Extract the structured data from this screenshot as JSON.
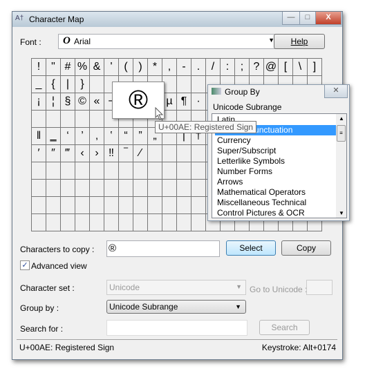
{
  "window": {
    "title": "Character Map",
    "minimize": "—",
    "maximize": "□",
    "close": "X"
  },
  "font": {
    "label": "Font :",
    "value": "Arial",
    "help": "Help"
  },
  "grid": [
    [
      "!",
      "\"",
      "#",
      "%",
      "&",
      "'",
      "(",
      ")",
      "*",
      ",",
      "-",
      ".",
      "/",
      ":",
      ";",
      "?",
      "@",
      "[",
      "\\",
      "]"
    ],
    [
      "_",
      "{",
      "|",
      "}",
      "",
      "",
      "",
      "",
      "",
      "",
      "",
      "",
      "",
      "",
      "",
      "",
      "",
      "",
      "",
      ""
    ],
    [
      "¡",
      "¦",
      "§",
      "©",
      "«",
      "¬",
      "",
      "",
      "",
      "µ",
      "¶",
      "·",
      "",
      "",
      "",
      "",
      "",
      "",
      "",
      ""
    ],
    [
      "",
      "",
      "",
      "",
      "",
      "",
      "",
      "",
      "",
      "",
      "",
      "",
      "",
      "",
      "",
      "",
      "",
      "",
      "",
      ""
    ],
    [
      "‖",
      "‗",
      "‘",
      "’",
      "‚",
      "‛",
      "“",
      "”",
      "„",
      "",
      "|",
      "†",
      "",
      "",
      "",
      "",
      "",
      "",
      "",
      ""
    ],
    [
      "′",
      "″",
      "‴",
      "‹",
      "›",
      "‼",
      "‾",
      "⁄",
      "",
      "",
      "",
      "",
      "",
      "",
      "",
      "",
      "",
      "",
      "",
      ""
    ],
    [
      "",
      "",
      "",
      "",
      "",
      "",
      "",
      "",
      "",
      "",
      "",
      "",
      "",
      "",
      "",
      "",
      "",
      "",
      "",
      ""
    ],
    [
      "",
      "",
      "",
      "",
      "",
      "",
      "",
      "",
      "",
      "",
      "",
      "",
      "",
      "",
      "",
      "",
      "",
      "",
      "",
      ""
    ],
    [
      "",
      "",
      "",
      "",
      "",
      "",
      "",
      "",
      "",
      "",
      "",
      "",
      "",
      "",
      "",
      "",
      "",
      "",
      "",
      ""
    ],
    [
      "",
      "",
      "",
      "",
      "",
      "",
      "",
      "",
      "",
      "",
      "",
      "",
      "",
      "",
      "",
      "",
      "",
      "",
      "",
      ""
    ]
  ],
  "magnifier": {
    "char": "®"
  },
  "tooltip": "U+00AE: Registered Sign",
  "groupBy": {
    "title": "Group By",
    "heading": "Unicode Subrange",
    "items": [
      "Latin",
      "General Punctuation",
      "Currency",
      "Super/Subscript",
      "Letterlike Symbols",
      "Number Forms",
      "Arrows",
      "Mathematical Operators",
      "Miscellaneous Technical",
      "Control Pictures & OCR"
    ],
    "selected": "General Punctuation"
  },
  "copy": {
    "label": "Characters to copy :",
    "value": "®",
    "select": "Select",
    "copy": "Copy"
  },
  "advanced": {
    "label": "Advanced view",
    "checked": true
  },
  "charset": {
    "label": "Character set :",
    "value": "Unicode",
    "goto": "Go to Unicode :"
  },
  "groupby": {
    "label": "Group by :",
    "value": "Unicode Subrange"
  },
  "search": {
    "label": "Search for :",
    "button": "Search",
    "value": ""
  },
  "status": {
    "left": "U+00AE: Registered Sign",
    "right": "Keystroke: Alt+0174"
  }
}
